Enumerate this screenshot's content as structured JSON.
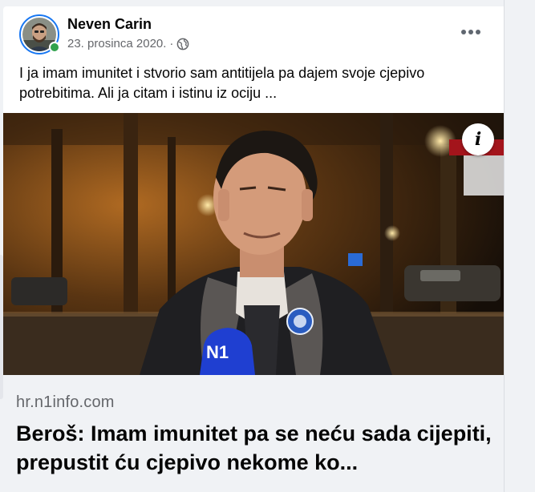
{
  "post": {
    "author": "Neven Carin",
    "date": "23. prosinca 2020.",
    "separator": "·",
    "privacy_icon": "globe-icon",
    "more_icon": "more-options-icon",
    "text": "I ja imam imunitet i stvorio sam antitijela pa dajem svoje cjepivo potrebitima. Ali ja citam i istinu iz ociju ..."
  },
  "link": {
    "image_text": "N1",
    "info_icon": "i",
    "domain": "hr.n1info.com",
    "title": "Beroš: Imam imunitet pa se neću sada cijepiti, prepustit ću cjepivo nekome ko..."
  },
  "colors": {
    "accent": "#1877f2",
    "online": "#31a24c",
    "secondary_text": "#65676b",
    "link_bg": "#f0f2f5"
  }
}
